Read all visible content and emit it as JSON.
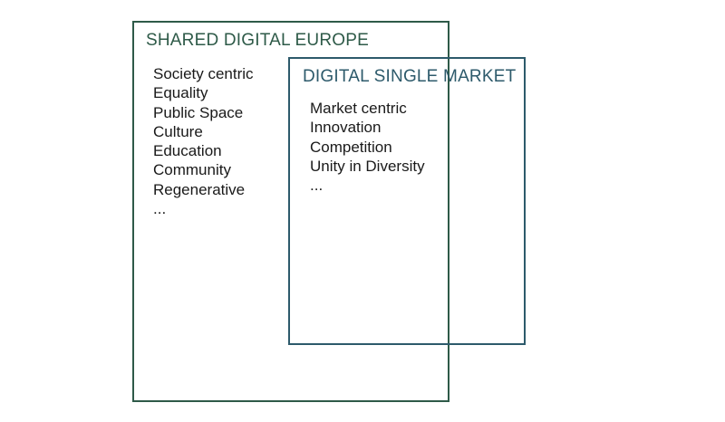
{
  "diagram": {
    "shared_digital_europe": {
      "title": "SHARED DIGITAL EUROPE",
      "color": "#2e5a48",
      "items": [
        "Society centric",
        "Equality",
        "Public Space",
        "Culture",
        "Education",
        "Community",
        "Regenerative",
        "..."
      ]
    },
    "digital_single_market": {
      "title": "DIGITAL SINGLE MARKET",
      "color": "#2d5a6b",
      "items": [
        "Market centric",
        "Innovation",
        "Competition",
        "Unity in Diversity",
        "..."
      ]
    }
  }
}
